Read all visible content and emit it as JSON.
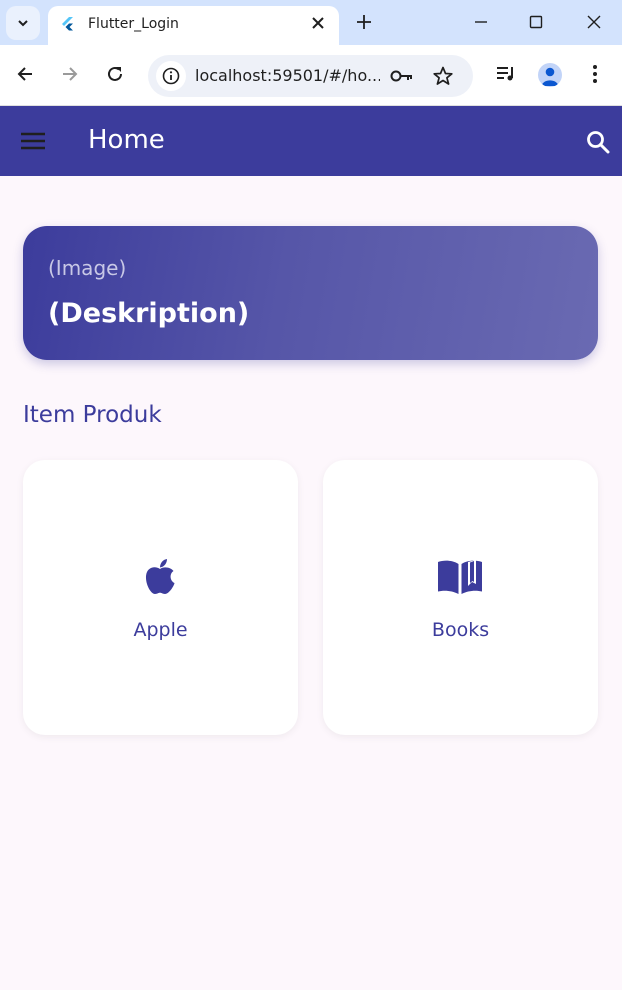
{
  "browser": {
    "tab_title": "Flutter_Login",
    "url": "localhost:59501/#/ho..."
  },
  "appbar": {
    "title": "Home"
  },
  "banner": {
    "image_text": "(Image)",
    "description": "(Deskription)"
  },
  "section": {
    "title": "Item Produk"
  },
  "products": [
    {
      "label": "Apple",
      "icon": "apple-icon"
    },
    {
      "label": "Books",
      "icon": "book-icon"
    }
  ],
  "colors": {
    "primary": "#3c3c9c",
    "background": "#fdf7fc",
    "card": "#ffffff"
  }
}
